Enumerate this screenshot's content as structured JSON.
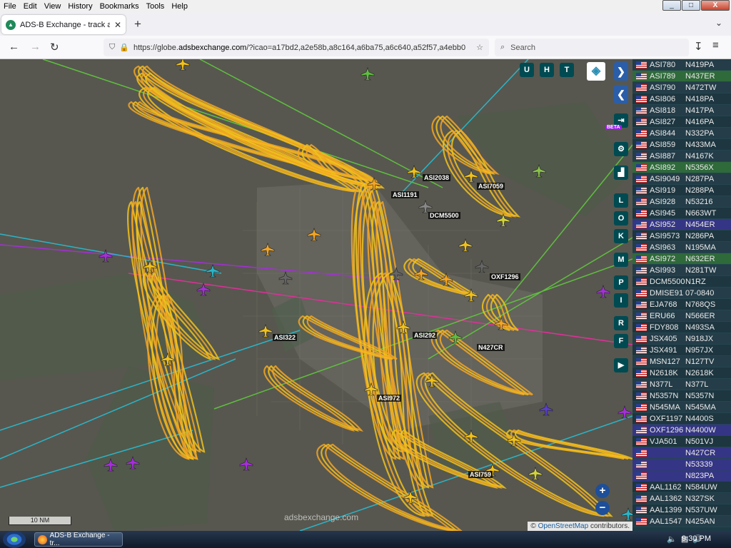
{
  "menu": [
    "File",
    "Edit",
    "View",
    "History",
    "Bookmarks",
    "Tools",
    "Help"
  ],
  "window_controls": {
    "minimize": "_",
    "maximize": "□",
    "close": "X"
  },
  "tab": {
    "title": "ADS-B Exchange - track aircraft",
    "close": "✕"
  },
  "new_tab": "+",
  "tab_menu": "⌄",
  "nav": {
    "back": "←",
    "forward": "→",
    "reload": "↻",
    "extensions": "↧",
    "menu": "≡"
  },
  "url": {
    "prefix": "https://globe.",
    "domain": "adsbexchange.com",
    "rest": "/?icao=a17bd2,a2e58b,a8c164,a6ba75,a6c640,a52f57,a4ebb0"
  },
  "search": {
    "placeholder": "Search"
  },
  "map_controls": {
    "top": [
      "U",
      "H",
      "T"
    ],
    "side": [
      "L",
      "O",
      "K",
      "M",
      "P",
      "I",
      "R",
      "F"
    ],
    "next": "❯",
    "prev": "❮",
    "expand": "◂▸",
    "login": "⇥",
    "beta": "BETA",
    "zoom_in": "+",
    "zoom_out": "−"
  },
  "map_labels": [
    "ASI1191",
    "ASI2038",
    "ASI7059",
    "DCM5500",
    "OXF1296",
    "ASI322",
    "ASI292",
    "N427CR",
    "ASI972",
    "ASI759"
  ],
  "attribution": {
    "prefix": "© ",
    "link": "OpenStreetMap",
    "suffix": " contributors."
  },
  "scale_label": "10 NM",
  "brand": "adsbexchange.com",
  "colors": {
    "track_yellow": "#f2c21a",
    "track_orange": "#f5a623",
    "plane_purple": "#a52fd8",
    "accent_teal": "#004a52"
  },
  "aircraft_list": [
    {
      "callsign": "ASI780",
      "reg": "N419PA",
      "hl": ""
    },
    {
      "callsign": "ASI789",
      "reg": "N437ER",
      "hl": "green"
    },
    {
      "callsign": "ASI790",
      "reg": "N472TW",
      "hl": ""
    },
    {
      "callsign": "ASI806",
      "reg": "N418PA",
      "hl": ""
    },
    {
      "callsign": "ASI818",
      "reg": "N417PA",
      "hl": ""
    },
    {
      "callsign": "ASI827",
      "reg": "N416PA",
      "hl": ""
    },
    {
      "callsign": "ASI844",
      "reg": "N332PA",
      "hl": ""
    },
    {
      "callsign": "ASI859",
      "reg": "N433MA",
      "hl": ""
    },
    {
      "callsign": "ASI887",
      "reg": "N4167K",
      "hl": ""
    },
    {
      "callsign": "ASI892",
      "reg": "N5356X",
      "hl": "green"
    },
    {
      "callsign": "ASI9049",
      "reg": "N287PA",
      "hl": ""
    },
    {
      "callsign": "ASI919",
      "reg": "N288PA",
      "hl": ""
    },
    {
      "callsign": "ASI928",
      "reg": "N53216",
      "hl": ""
    },
    {
      "callsign": "ASI945",
      "reg": "N663WT",
      "hl": ""
    },
    {
      "callsign": "ASI952",
      "reg": "N454ER",
      "hl": "blue"
    },
    {
      "callsign": "ASI9573",
      "reg": "N286PA",
      "hl": ""
    },
    {
      "callsign": "ASI963",
      "reg": "N195MA",
      "hl": ""
    },
    {
      "callsign": "ASI972",
      "reg": "N632ER",
      "hl": "green"
    },
    {
      "callsign": "ASI993",
      "reg": "N281TW",
      "hl": ""
    },
    {
      "callsign": "DCM5500",
      "reg": "N1RZ",
      "hl": ""
    },
    {
      "callsign": "DMISE91",
      "reg": "07-0840",
      "hl": ""
    },
    {
      "callsign": "EJA768",
      "reg": "N768QS",
      "hl": ""
    },
    {
      "callsign": "ERU66",
      "reg": "N566ER",
      "hl": ""
    },
    {
      "callsign": "FDY808",
      "reg": "N493SA",
      "hl": ""
    },
    {
      "callsign": "JSX405",
      "reg": "N918JX",
      "hl": ""
    },
    {
      "callsign": "JSX491",
      "reg": "N957JX",
      "hl": ""
    },
    {
      "callsign": "MSN127",
      "reg": "N127TV",
      "hl": ""
    },
    {
      "callsign": "N2618K",
      "reg": "N2618K",
      "hl": ""
    },
    {
      "callsign": "N377L",
      "reg": "N377L",
      "hl": ""
    },
    {
      "callsign": "N5357N",
      "reg": "N5357N",
      "hl": ""
    },
    {
      "callsign": "N545MA",
      "reg": "N545MA",
      "hl": ""
    },
    {
      "callsign": "OXF1197",
      "reg": "N4400S",
      "hl": ""
    },
    {
      "callsign": "OXF1296",
      "reg": "N4400W",
      "hl": "blue"
    },
    {
      "callsign": "VJA501",
      "reg": "N501VJ",
      "hl": ""
    },
    {
      "callsign": "",
      "reg": "N427CR",
      "hl": "blue"
    },
    {
      "callsign": "",
      "reg": "N53339",
      "hl": "blue"
    },
    {
      "callsign": "",
      "reg": "N823PA",
      "hl": "blue"
    },
    {
      "callsign": "AAL1162",
      "reg": "N584UW",
      "hl": ""
    },
    {
      "callsign": "AAL1362",
      "reg": "N327SK",
      "hl": ""
    },
    {
      "callsign": "AAL1399",
      "reg": "N537UW",
      "hl": ""
    },
    {
      "callsign": "AAL1547",
      "reg": "N425AN",
      "hl": ""
    }
  ],
  "taskbar": {
    "app_title": "ADS-B Exchange - tr...",
    "time": "9:30 PM"
  }
}
